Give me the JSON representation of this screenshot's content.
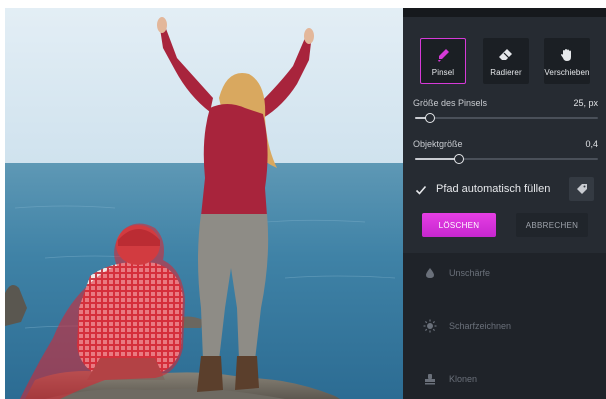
{
  "tools": {
    "brush": {
      "label": "Pinsel",
      "active": true
    },
    "eraser": {
      "label": "Radierer"
    },
    "move": {
      "label": "Verschieben"
    }
  },
  "brush_size": {
    "label": "Größe des Pinsels",
    "value_text": "25, px",
    "value_fraction": 0.08
  },
  "object_size": {
    "label": "Objektgröße",
    "value_text": "0,4",
    "value_fraction": 0.24
  },
  "auto_fill": {
    "label": "Pfad automatisch füllen",
    "checked": true
  },
  "actions": {
    "delete_label": "LÖSCHEN",
    "cancel_label": "ABBRECHEN"
  },
  "menu": [
    {
      "label": "Unschärfe",
      "icon": "drop-icon"
    },
    {
      "label": "Scharfzeichnen",
      "icon": "sun-icon"
    },
    {
      "label": "Klonen",
      "icon": "stamp-icon"
    }
  ],
  "colors": {
    "accent": "#d63ad8",
    "panel": "#1f2329",
    "tool_panel": "#262b32",
    "selection_overlay": "#e0202e"
  }
}
